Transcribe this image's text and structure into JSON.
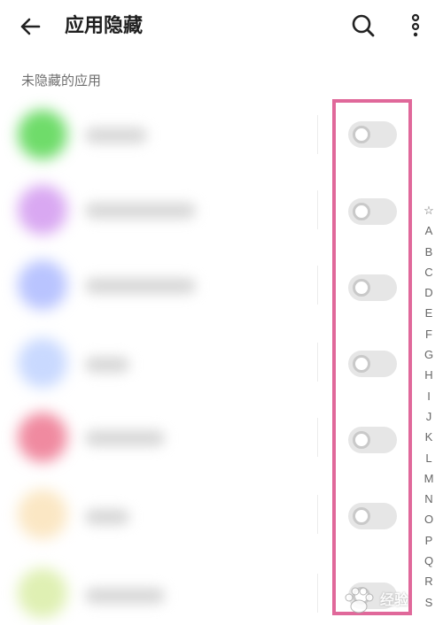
{
  "header": {
    "title": "应用隐藏"
  },
  "section": {
    "label": "未隐藏的应用"
  },
  "apps": [
    {
      "icon_color": "#6fdc6a",
      "toggle_on": false
    },
    {
      "icon_color": "#d9a8f2",
      "toggle_on": false
    },
    {
      "icon_color": "#b9c4ff",
      "toggle_on": false
    },
    {
      "icon_color": "#c9d9ff",
      "toggle_on": false
    },
    {
      "icon_color": "#f08aa0",
      "toggle_on": false
    },
    {
      "icon_color": "#fbe7c4",
      "toggle_on": false
    },
    {
      "icon_color": "#dff0b3",
      "toggle_on": false
    }
  ],
  "alphabet_index": [
    "☆",
    "A",
    "B",
    "C",
    "D",
    "E",
    "F",
    "G",
    "H",
    "I",
    "J",
    "K",
    "L",
    "M",
    "N",
    "O",
    "P",
    "Q",
    "R",
    "S"
  ],
  "colors": {
    "highlight": "#e0689a",
    "toggle_off": "#e6e6e6"
  },
  "watermark": {
    "text": "经验"
  }
}
